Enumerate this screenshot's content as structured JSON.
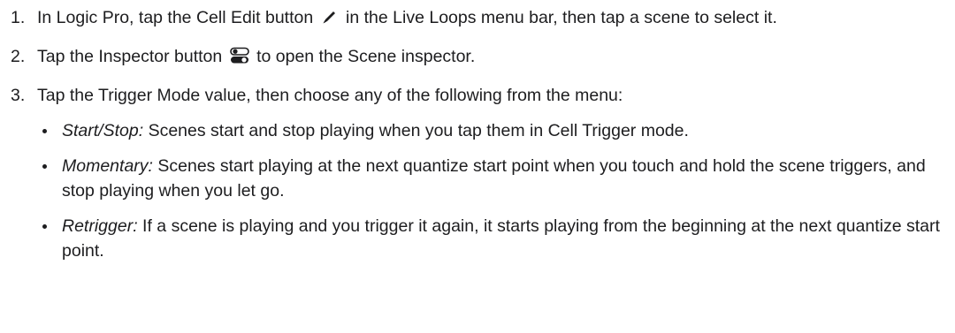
{
  "steps": [
    {
      "number": "1.",
      "text_before": "In Logic Pro, tap the Cell Edit button",
      "icon": "pencil-icon",
      "text_after": "in the Live Loops menu bar, then tap a scene to select it."
    },
    {
      "number": "2.",
      "text_before": "Tap the Inspector button",
      "icon": "inspector-toggle-icon",
      "text_after": "to open the Scene inspector."
    },
    {
      "number": "3.",
      "text": "Tap the Trigger Mode value, then choose any of the following from the menu:",
      "options": [
        {
          "term": "Start/Stop:",
          "description": "Scenes start and stop playing when you tap them in Cell Trigger mode."
        },
        {
          "term": "Momentary:",
          "description": "Scenes start playing at the next quantize start point when you touch and hold the scene triggers, and stop playing when you let go."
        },
        {
          "term": "Retrigger:",
          "description": "If a scene is playing and you trigger it again, it starts playing from the beginning at the next quantize start point."
        }
      ]
    }
  ]
}
